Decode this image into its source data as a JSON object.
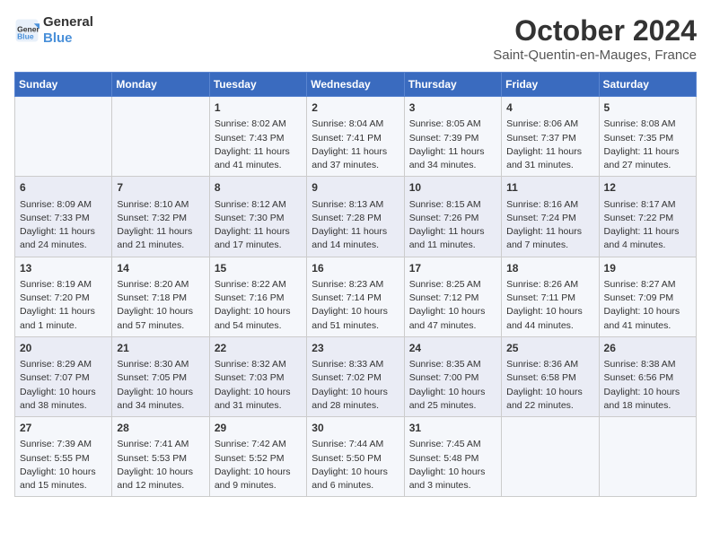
{
  "header": {
    "logo_line1": "General",
    "logo_line2": "Blue",
    "title": "October 2024",
    "subtitle": "Saint-Quentin-en-Mauges, France"
  },
  "columns": [
    "Sunday",
    "Monday",
    "Tuesday",
    "Wednesday",
    "Thursday",
    "Friday",
    "Saturday"
  ],
  "weeks": [
    [
      {
        "day": "",
        "text": ""
      },
      {
        "day": "",
        "text": ""
      },
      {
        "day": "1",
        "text": "Sunrise: 8:02 AM\nSunset: 7:43 PM\nDaylight: 11 hours and 41 minutes."
      },
      {
        "day": "2",
        "text": "Sunrise: 8:04 AM\nSunset: 7:41 PM\nDaylight: 11 hours and 37 minutes."
      },
      {
        "day": "3",
        "text": "Sunrise: 8:05 AM\nSunset: 7:39 PM\nDaylight: 11 hours and 34 minutes."
      },
      {
        "day": "4",
        "text": "Sunrise: 8:06 AM\nSunset: 7:37 PM\nDaylight: 11 hours and 31 minutes."
      },
      {
        "day": "5",
        "text": "Sunrise: 8:08 AM\nSunset: 7:35 PM\nDaylight: 11 hours and 27 minutes."
      }
    ],
    [
      {
        "day": "6",
        "text": "Sunrise: 8:09 AM\nSunset: 7:33 PM\nDaylight: 11 hours and 24 minutes."
      },
      {
        "day": "7",
        "text": "Sunrise: 8:10 AM\nSunset: 7:32 PM\nDaylight: 11 hours and 21 minutes."
      },
      {
        "day": "8",
        "text": "Sunrise: 8:12 AM\nSunset: 7:30 PM\nDaylight: 11 hours and 17 minutes."
      },
      {
        "day": "9",
        "text": "Sunrise: 8:13 AM\nSunset: 7:28 PM\nDaylight: 11 hours and 14 minutes."
      },
      {
        "day": "10",
        "text": "Sunrise: 8:15 AM\nSunset: 7:26 PM\nDaylight: 11 hours and 11 minutes."
      },
      {
        "day": "11",
        "text": "Sunrise: 8:16 AM\nSunset: 7:24 PM\nDaylight: 11 hours and 7 minutes."
      },
      {
        "day": "12",
        "text": "Sunrise: 8:17 AM\nSunset: 7:22 PM\nDaylight: 11 hours and 4 minutes."
      }
    ],
    [
      {
        "day": "13",
        "text": "Sunrise: 8:19 AM\nSunset: 7:20 PM\nDaylight: 11 hours and 1 minute."
      },
      {
        "day": "14",
        "text": "Sunrise: 8:20 AM\nSunset: 7:18 PM\nDaylight: 10 hours and 57 minutes."
      },
      {
        "day": "15",
        "text": "Sunrise: 8:22 AM\nSunset: 7:16 PM\nDaylight: 10 hours and 54 minutes."
      },
      {
        "day": "16",
        "text": "Sunrise: 8:23 AM\nSunset: 7:14 PM\nDaylight: 10 hours and 51 minutes."
      },
      {
        "day": "17",
        "text": "Sunrise: 8:25 AM\nSunset: 7:12 PM\nDaylight: 10 hours and 47 minutes."
      },
      {
        "day": "18",
        "text": "Sunrise: 8:26 AM\nSunset: 7:11 PM\nDaylight: 10 hours and 44 minutes."
      },
      {
        "day": "19",
        "text": "Sunrise: 8:27 AM\nSunset: 7:09 PM\nDaylight: 10 hours and 41 minutes."
      }
    ],
    [
      {
        "day": "20",
        "text": "Sunrise: 8:29 AM\nSunset: 7:07 PM\nDaylight: 10 hours and 38 minutes."
      },
      {
        "day": "21",
        "text": "Sunrise: 8:30 AM\nSunset: 7:05 PM\nDaylight: 10 hours and 34 minutes."
      },
      {
        "day": "22",
        "text": "Sunrise: 8:32 AM\nSunset: 7:03 PM\nDaylight: 10 hours and 31 minutes."
      },
      {
        "day": "23",
        "text": "Sunrise: 8:33 AM\nSunset: 7:02 PM\nDaylight: 10 hours and 28 minutes."
      },
      {
        "day": "24",
        "text": "Sunrise: 8:35 AM\nSunset: 7:00 PM\nDaylight: 10 hours and 25 minutes."
      },
      {
        "day": "25",
        "text": "Sunrise: 8:36 AM\nSunset: 6:58 PM\nDaylight: 10 hours and 22 minutes."
      },
      {
        "day": "26",
        "text": "Sunrise: 8:38 AM\nSunset: 6:56 PM\nDaylight: 10 hours and 18 minutes."
      }
    ],
    [
      {
        "day": "27",
        "text": "Sunrise: 7:39 AM\nSunset: 5:55 PM\nDaylight: 10 hours and 15 minutes."
      },
      {
        "day": "28",
        "text": "Sunrise: 7:41 AM\nSunset: 5:53 PM\nDaylight: 10 hours and 12 minutes."
      },
      {
        "day": "29",
        "text": "Sunrise: 7:42 AM\nSunset: 5:52 PM\nDaylight: 10 hours and 9 minutes."
      },
      {
        "day": "30",
        "text": "Sunrise: 7:44 AM\nSunset: 5:50 PM\nDaylight: 10 hours and 6 minutes."
      },
      {
        "day": "31",
        "text": "Sunrise: 7:45 AM\nSunset: 5:48 PM\nDaylight: 10 hours and 3 minutes."
      },
      {
        "day": "",
        "text": ""
      },
      {
        "day": "",
        "text": ""
      }
    ]
  ]
}
